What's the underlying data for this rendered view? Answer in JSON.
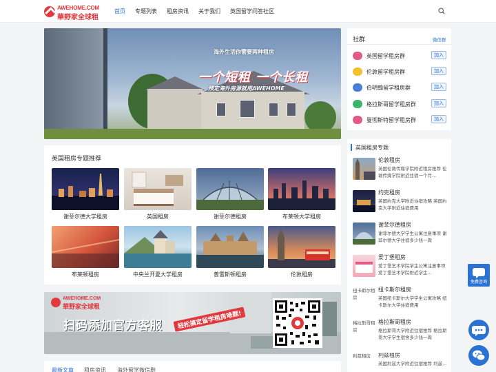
{
  "header": {
    "logo_en": "AWEHOME.COM",
    "logo_cn": "華野家全球租",
    "nav": [
      "首页",
      "专题列表",
      "租房资讯",
      "关于我们",
      "英国留学问答社区"
    ],
    "active_index": 0
  },
  "hero": {
    "line1": "海外生活你需要两种租房",
    "line2": "一个短租  一个长租",
    "line3": "预定海外房源就用AWEHOME"
  },
  "topics": {
    "title": "英国租房专题推荐",
    "items": [
      {
        "label": "谢菲尔德大学租房"
      },
      {
        "label": "英国租房"
      },
      {
        "label": "谢菲尔德租房"
      },
      {
        "label": "布莱顿大学租房"
      },
      {
        "label": "布莱顿租房"
      },
      {
        "label": "中央兰开夏大学租房"
      },
      {
        "label": "普雷斯顿租房"
      },
      {
        "label": "伦敦租房"
      }
    ]
  },
  "qr_banner": {
    "logo_en": "AWEHOME.COM",
    "logo_cn": "華野家全球租",
    "main": "扫码添加官方客服",
    "sub": "轻松搞定留学租房难题!"
  },
  "tabs": {
    "items": [
      "最新文章",
      "租房资讯",
      "海外留学微信群"
    ],
    "active_index": 0
  },
  "social": {
    "title": "社群",
    "more": "微信群",
    "join_label": "加入",
    "groups": [
      {
        "name": "英国留学租房群",
        "color": "#e25b86"
      },
      {
        "name": "伦敦留学租房群",
        "color": "#f2c12e"
      },
      {
        "name": "伯明翰留学租房群",
        "color": "#4a7fd6"
      },
      {
        "name": "格拉斯哥留学租房群",
        "color": "#3bb36a"
      },
      {
        "name": "曼彻斯特留学租房群",
        "color": "#e25b86"
      }
    ]
  },
  "topic_list": {
    "title": "英国租房专题",
    "items": [
      {
        "title": "伦敦租房",
        "desc": "英国伦敦传媒学院附近租房推荐 伦敦传媒学院附近住宿一个月...",
        "alt": ""
      },
      {
        "title": "约克租房",
        "desc": "英国约克大学附近住宿攻略 英国约克大学附近住宿费用",
        "alt": ""
      },
      {
        "title": "谢菲尔德租房",
        "desc": "谢菲尔德大学学生公寓注意事项 谢菲尔德大学住宿多少钱一周",
        "alt": ""
      },
      {
        "title": "爱丁堡租房",
        "desc": "爱丁堡艺术学院学生公寓注意事项 爱丁堡艺术学院附近学生...",
        "alt": ""
      },
      {
        "title": "纽卡斯尔租房",
        "desc": "英国纽卡斯尔大学学生公寓攻略 纽卡斯尔大学住宿费用",
        "alt": "纽卡斯尔租房"
      },
      {
        "title": "格拉斯哥租房",
        "desc": "格拉斯哥大学附近住宿推荐 格拉斯哥大学学生宿舍多少钱一周",
        "alt": "格拉斯哥租房"
      },
      {
        "title": "利兹租房",
        "desc": "英国利兹大学附近住宿推荐 利兹...",
        "alt": "利兹租房"
      }
    ]
  },
  "float": {
    "service_label": "免费咨询"
  }
}
